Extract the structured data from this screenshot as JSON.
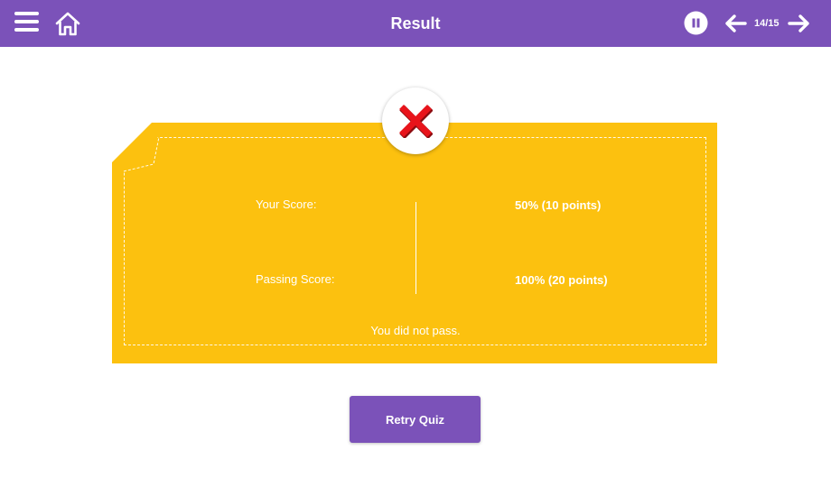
{
  "header": {
    "title": "Result",
    "page_counter": "14/15",
    "icons": {
      "menu": "hamburger-menu-icon",
      "home": "home-icon",
      "pause": "pause-icon",
      "prev": "arrow-left-icon",
      "next": "arrow-right-icon"
    }
  },
  "result": {
    "status_icon": "fail-x-icon",
    "your_score_label": "Your Score:",
    "your_score_value": "50% (10 points)",
    "passing_score_label": "Passing Score:",
    "passing_score_value": "100% (20 points)",
    "message": "You did not pass."
  },
  "actions": {
    "retry_label": "Retry Quiz"
  },
  "colors": {
    "accent": "#7b52b9",
    "card": "#fcc10f",
    "fail": "#e8141b"
  }
}
